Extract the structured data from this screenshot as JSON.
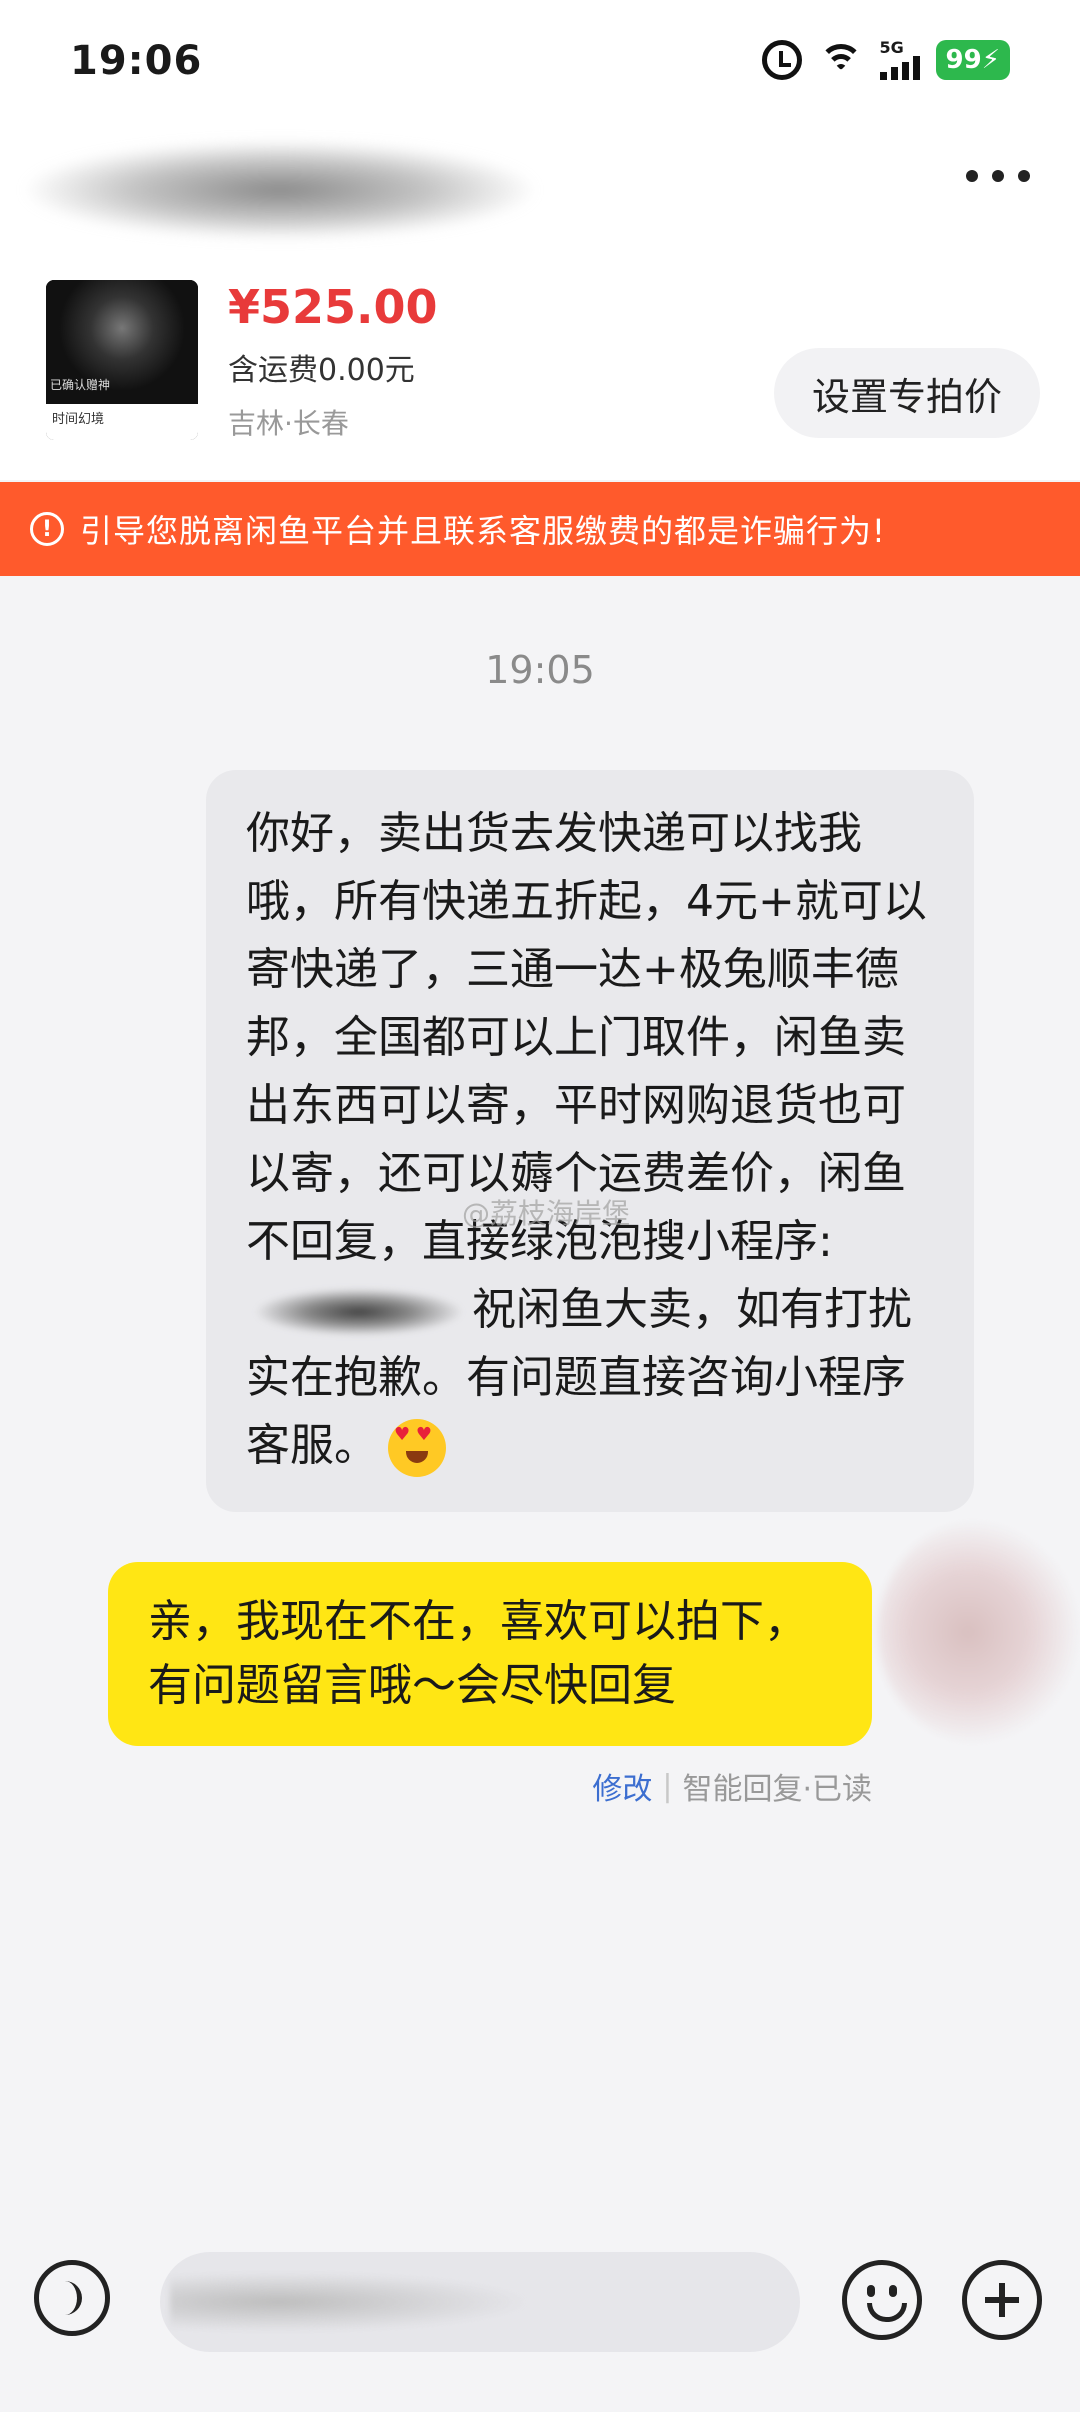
{
  "status_bar": {
    "time": "19:06",
    "network": "5G",
    "battery": "99"
  },
  "header": {
    "product": {
      "thumbnail_tag": "已确认赠神",
      "thumbnail_caption": "时间幻境",
      "price": "¥525.00",
      "shipping": "含运费0.00元",
      "location": "吉林·长春"
    },
    "set_price_label": "设置专拍价"
  },
  "warning": {
    "icon": "!",
    "text": "引导您脱离闲鱼平台并且联系客服缴费的都是诈骗行为!"
  },
  "chat": {
    "timestamp": "19:05",
    "incoming": {
      "text_before_id": "你好，卖出货去发快递可以找我哦，所有快递五折起，4元+就可以寄快递了，三通一达+极兔顺丰德邦，全国都可以上门取件，闲鱼卖出东西可以寄，平时网购退货也可以寄，还可以薅个运费差价，闲鱼不回复，直接绿泡泡搜小程序:",
      "text_after_id": "祝闲鱼大卖，如有打扰实在抱歉。有问题直接咨询小程序客服。"
    },
    "outgoing": {
      "text": "亲，我现在不在，喜欢可以拍下，有问题留言哦～会尽快回复",
      "edit_label": "修改",
      "separator": "|",
      "status": "智能回复·已读"
    },
    "watermark": "@荔枝海岸堡"
  },
  "colors": {
    "price": "#e83a3a",
    "warning_bg": "#ff5a2c",
    "outgoing_bubble": "#ffe614",
    "incoming_bubble": "#e9e9ec"
  },
  "icons": [
    "alarm-icon",
    "wifi-icon",
    "signal-icon",
    "battery-icon",
    "more-icon",
    "warning-icon",
    "emoji-heart-eyes-icon",
    "voice-icon",
    "emoji-icon",
    "plus-icon"
  ]
}
